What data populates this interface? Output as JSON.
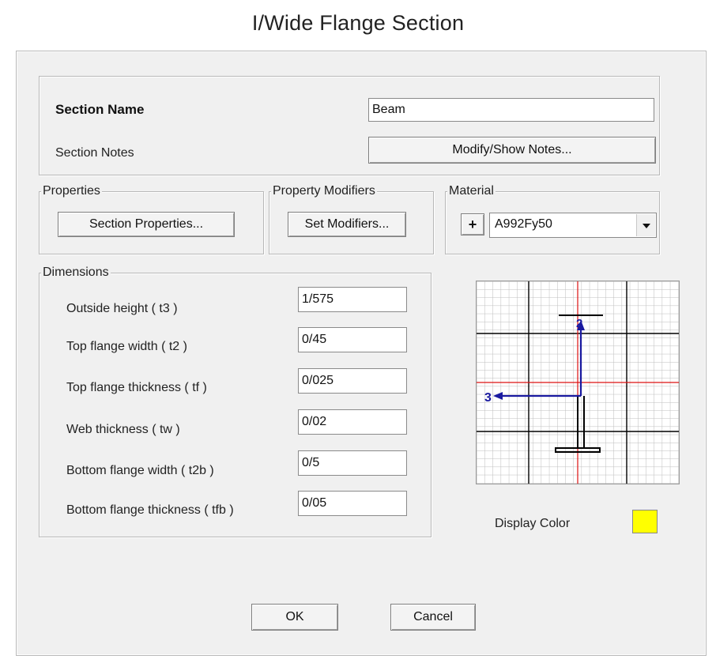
{
  "window": {
    "title": "I/Wide Flange Section"
  },
  "section": {
    "name_label": "Section Name",
    "name_value": "Beam",
    "notes_label": "Section Notes",
    "notes_button": "Modify/Show Notes..."
  },
  "properties": {
    "legend": "Properties",
    "button": "Section Properties..."
  },
  "modifiers": {
    "legend": "Property Modifiers",
    "button": "Set Modifiers..."
  },
  "material": {
    "legend": "Material",
    "plus": "+",
    "selected": "A992Fy50"
  },
  "dimensions": {
    "legend": "Dimensions",
    "rows": [
      {
        "label": "Outside height  ( t3 )",
        "value": "1/575"
      },
      {
        "label": "Top flange width  ( t2 )",
        "value": "0/45"
      },
      {
        "label": "Top flange thickness  ( tf )",
        "value": "0/025"
      },
      {
        "label": "Web thickness  ( tw )",
        "value": "0/02"
      },
      {
        "label": "Bottom flange width  ( t2b )",
        "value": "0/5"
      },
      {
        "label": "Bottom flange thickness  ( tfb )",
        "value": "0/05"
      }
    ]
  },
  "preview": {
    "axis_2": "2",
    "axis_3": "3"
  },
  "display_color": {
    "label": "Display Color",
    "color": "#ffff00"
  },
  "buttons": {
    "ok": "OK",
    "cancel": "Cancel"
  }
}
